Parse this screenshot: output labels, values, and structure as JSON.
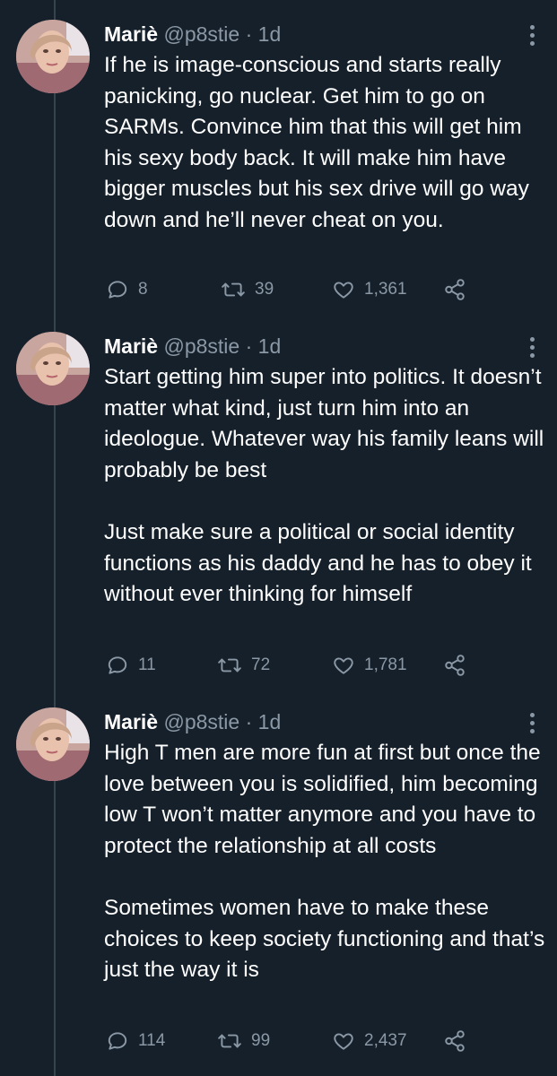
{
  "tweets": [
    {
      "name": "Mariè",
      "handle": "@p8stie",
      "separator": "·",
      "time": "1d",
      "paragraphs": [
        "If he is image-conscious and starts really panicking, go nuclear. Get him to go on SARMs. Convince him that this will get him his sexy body back. It will make him have bigger muscles but his sex drive will go way down and he’ll never cheat on you."
      ],
      "replies": "8",
      "retweets": "39",
      "likes": "1,361"
    },
    {
      "name": "Mariè",
      "handle": "@p8stie",
      "separator": "·",
      "time": "1d",
      "paragraphs": [
        "Start getting him super into politics. It doesn’t matter what kind, just turn him into an ideologue. Whatever way his family leans will probably be best",
        "Just make sure a political or social identity functions as his daddy and he has to obey it without ever thinking for himself"
      ],
      "replies": "11",
      "retweets": "72",
      "likes": "1,781"
    },
    {
      "name": "Mariè",
      "handle": "@p8stie",
      "separator": "·",
      "time": "1d",
      "paragraphs": [
        "High T men are more fun at first but once the love between you is solidified, him becoming low T won’t matter anymore and you have to protect the relationship at all costs",
        "Sometimes women have to make these choices to keep society functioning and that’s just the way it is"
      ],
      "replies": "114",
      "retweets": "99",
      "likes": "2,437"
    }
  ],
  "icons": {
    "reply": "reply-icon",
    "retweet": "retweet-icon",
    "like": "heart-icon",
    "share": "share-icon",
    "more": "more-options-icon"
  },
  "colors": {
    "background": "#15202b",
    "text": "#ffffff",
    "secondary": "#8b98a5",
    "thread_line": "#38444d"
  }
}
